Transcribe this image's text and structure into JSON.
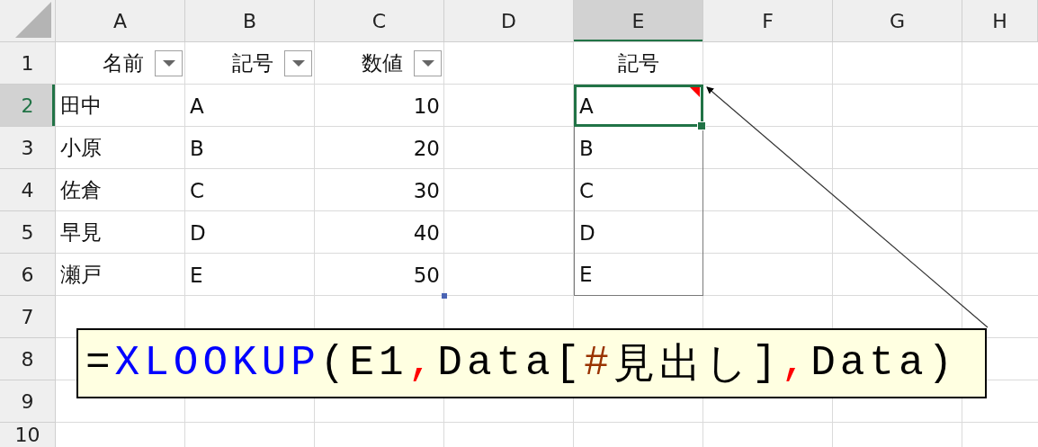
{
  "column_headers": [
    {
      "label": "A",
      "selected": false
    },
    {
      "label": "B",
      "selected": false
    },
    {
      "label": "C",
      "selected": false
    },
    {
      "label": "D",
      "selected": false
    },
    {
      "label": "E",
      "selected": true
    },
    {
      "label": "F",
      "selected": false
    },
    {
      "label": "G",
      "selected": false
    },
    {
      "label": "H",
      "selected": false
    }
  ],
  "row_headers": [
    {
      "label": "1",
      "selected": false
    },
    {
      "label": "2",
      "selected": true
    },
    {
      "label": "3",
      "selected": false
    },
    {
      "label": "4",
      "selected": false
    },
    {
      "label": "5",
      "selected": false
    },
    {
      "label": "6",
      "selected": false
    },
    {
      "label": "7",
      "selected": false
    },
    {
      "label": "8",
      "selected": false
    },
    {
      "label": "9",
      "selected": false
    },
    {
      "label": "10",
      "selected": false
    }
  ],
  "data_table": {
    "columns": [
      "名前",
      "記号",
      "数値"
    ],
    "rows": [
      [
        "田中",
        "A",
        "10"
      ],
      [
        "小原",
        "B",
        "20"
      ],
      [
        "佐倉",
        "C",
        "30"
      ],
      [
        "早見",
        "D",
        "40"
      ],
      [
        "瀬戸",
        "E",
        "50"
      ]
    ]
  },
  "lookup_list": {
    "header": "記号",
    "items": [
      {
        "text": "A",
        "selected": true,
        "has_comment": true
      },
      {
        "text": "B",
        "selected": false,
        "has_comment": false
      },
      {
        "text": "C",
        "selected": false,
        "has_comment": false
      },
      {
        "text": "D",
        "selected": false,
        "has_comment": false
      },
      {
        "text": "E",
        "selected": false,
        "has_comment": false
      }
    ]
  },
  "callout": {
    "segments": [
      {
        "text": "=",
        "color": "#000000"
      },
      {
        "text": "XLOOKUP",
        "color": "#0000ff"
      },
      {
        "text": "(E1",
        "color": "#000000"
      },
      {
        "text": ",",
        "color": "#ff0000"
      },
      {
        "text": "Data[",
        "color": "#000000"
      },
      {
        "text": "#",
        "color": "#993300"
      },
      {
        "text": "見出し",
        "color": "#000000"
      },
      {
        "text": "]",
        "color": "#000000"
      },
      {
        "text": ",",
        "color": "#ff0000"
      },
      {
        "text": "Data)",
        "color": "#000000"
      }
    ]
  }
}
